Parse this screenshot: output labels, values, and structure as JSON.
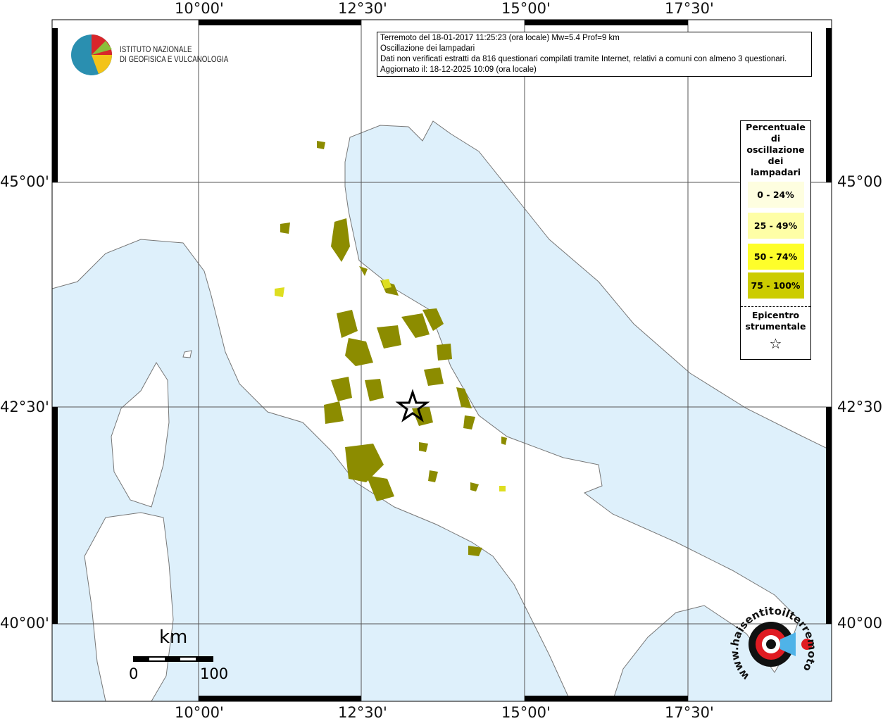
{
  "map": {
    "lon_labels": [
      "10°00'",
      "12°30'",
      "15°00'",
      "17°30'"
    ],
    "lat_labels": [
      "45°00'",
      "42°30'",
      "40°00'"
    ],
    "colors": {
      "sea": "#def0fb",
      "land": "#ffffff",
      "borders": "#9a9a9a",
      "felt_fill": "#8c8c00",
      "felt_light": "#dede20"
    }
  },
  "info": {
    "line1": "Terremoto del 18-01-2017 11:25:23 (ora locale) Mw=5.4 Prof=9 km",
    "line2": "Oscillazione dei lampadari",
    "line3": "Dati non verificati estratti da 816 questionari compilati tramite Internet, relativi a comuni con almeno 3 questionari.",
    "line4": "Aggiornato il: 18-12-2025 10:09 (ora locale)"
  },
  "legend": {
    "title_lines": [
      "Percentuale",
      "di",
      "oscillazione",
      "dei",
      "lampadari"
    ],
    "classes": [
      {
        "label": "0 - 24%",
        "color": "#fefee0"
      },
      {
        "label": "25 - 49%",
        "color": "#fefea6"
      },
      {
        "label": "50 - 74%",
        "color": "#fefe2a"
      },
      {
        "label": "75 - 100%",
        "color": "#cccc00"
      }
    ],
    "epicenter_lines": [
      "Epicentro",
      "strumentale"
    ],
    "epicenter_symbol": "☆"
  },
  "logo": {
    "line1": "ISTITUTO NAZIONALE",
    "line2": "DI GEOFISICA E VULCANOLOGIA"
  },
  "hst_logo": {
    "text": "www.haisentitoilterremoto.it"
  },
  "scale": {
    "unit": "km",
    "start": "0",
    "end": "100"
  }
}
